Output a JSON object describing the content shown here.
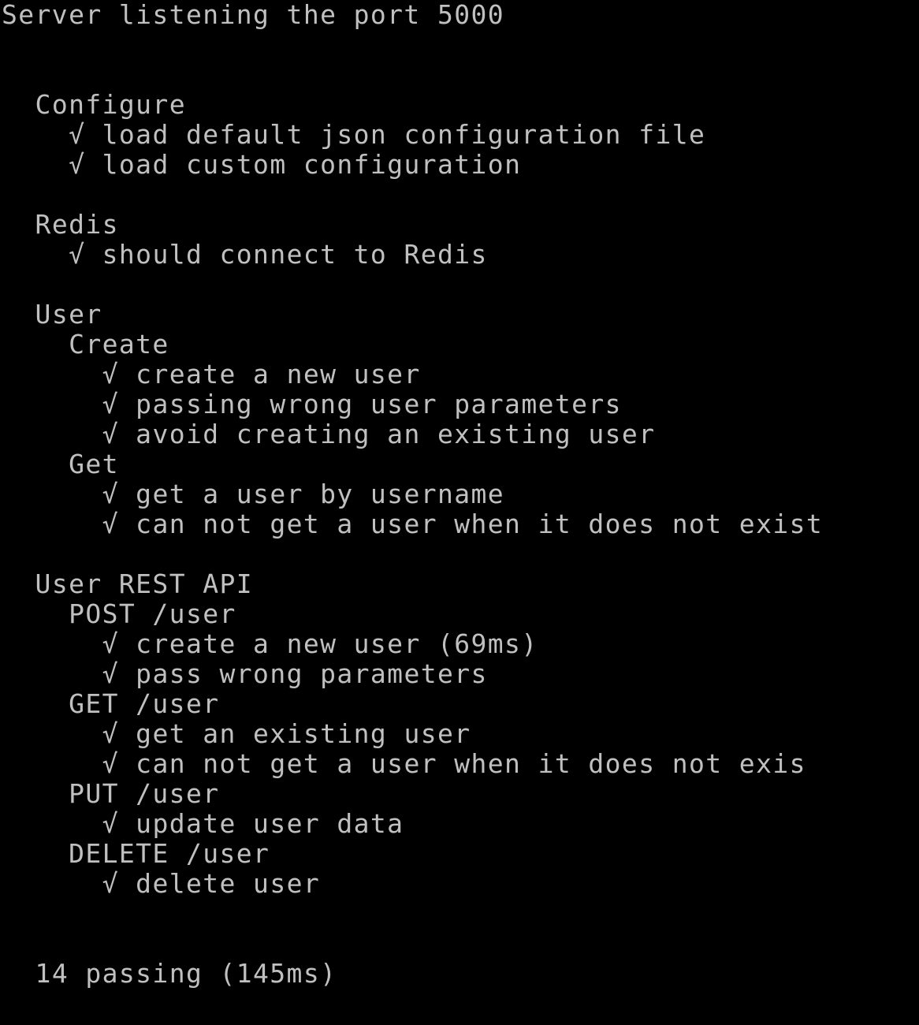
{
  "terminal": {
    "background": "#000000",
    "foreground": "#c0c0c0",
    "check_glyph": "√",
    "server_message": "Server listening the port 5000",
    "suites": [
      {
        "title": "Configure",
        "tests": [
          "load default json configuration file",
          "load custom configuration"
        ]
      },
      {
        "title": "Redis",
        "tests": [
          "should connect to Redis"
        ]
      },
      {
        "title": "User",
        "groups": [
          {
            "title": "Create",
            "tests": [
              "create a new user",
              "passing wrong user parameters",
              "avoid creating an existing user"
            ]
          },
          {
            "title": "Get",
            "tests": [
              "get a user by username",
              "can not get a user when it does not exist"
            ]
          }
        ]
      },
      {
        "title": "User REST API",
        "groups": [
          {
            "title": "POST /user",
            "tests": [
              "create a new user (69ms)",
              "pass wrong parameters"
            ]
          },
          {
            "title": "GET /user",
            "tests": [
              "get an existing user",
              "can not get a user when it does not exis"
            ]
          },
          {
            "title": "PUT /user",
            "tests": [
              "update user data"
            ]
          },
          {
            "title": "DELETE /user",
            "tests": [
              "delete user"
            ]
          }
        ]
      }
    ],
    "summary": "14 passing (145ms)"
  }
}
